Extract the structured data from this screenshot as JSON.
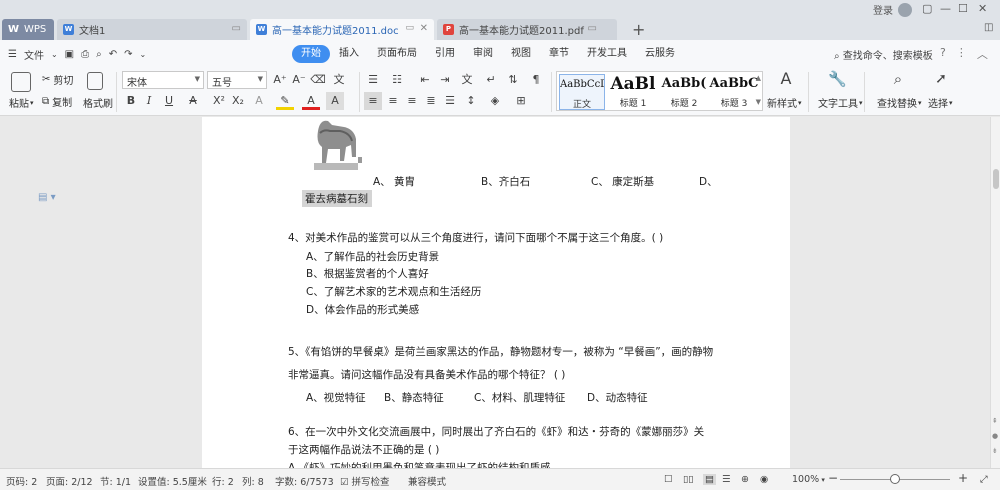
{
  "tabs": {
    "wps": "WPS",
    "doc1": "文档1",
    "doc2": "高一基本能力试题2011.doc",
    "pdf": "高一基本能力试题2011.pdf",
    "new_tab": "+"
  },
  "account": {
    "login": "登录"
  },
  "menubar": {
    "file": "文件",
    "items": [
      "开始",
      "插入",
      "页面布局",
      "引用",
      "审阅",
      "视图",
      "章节",
      "开发工具",
      "云服务"
    ],
    "active_index": 0,
    "search": "查找命令、搜索模板",
    "help": "?"
  },
  "ribbon": {
    "paste": "粘贴",
    "cut": "剪切",
    "copy": "复制",
    "format_painter": "格式刷",
    "font_name": "宋体",
    "font_size": "五号",
    "styles": [
      {
        "sample": "AaBbCcDd",
        "name": "正文"
      },
      {
        "sample": "AaBl",
        "name": "标题 1"
      },
      {
        "sample": "AaBb(",
        "name": "标题 2"
      },
      {
        "sample": "AaBbC",
        "name": "标题 3"
      }
    ],
    "new_style": "新样式",
    "text_tools": "文字工具",
    "find_replace": "查找替换",
    "select": "选择"
  },
  "document": {
    "q3_options": [
      "A、  黄胄",
      "B、齐白石",
      "C、  康定斯基",
      "D、"
    ],
    "q3_option_d_cont": "霍去病墓石刻",
    "q4": "4、对美术作品的鉴赏可以从三个角度进行，请问下面哪个不属于这三个角度。(                )",
    "q4_options": [
      "A、了解作品的社会历史背景",
      "B、根据鉴赏者的个人喜好",
      "C、了解艺术家的艺术观点和生活经历",
      "D、体会作品的形式美感"
    ],
    "q5_line1": "5、《有馅饼的早餐桌》是荷兰画家黑达的作品，静物题材专一，被称为 “早餐画”，画的静物",
    "q5_line2": "非常逼真。请问这幅作品没有具备美术作品的哪个特征？                  (                )",
    "q5_options": [
      "A、视觉特征",
      "B、静态特征",
      "C、材料、肌理特征",
      "D、动态特征"
    ],
    "q6_line1": "6、在一次中外文化交流画展中，同时展出了齐白石的《虾》和达・芬奇的《蒙娜丽莎》关",
    "q6_line2": "于这两幅作品说法不正确的是                                          (                )",
    "q6_line3": "A 《虾》巧妙的利用墨色和笔意表现出了虾的结构和质感"
  },
  "statusbar": {
    "page_no": "页码: 2",
    "pages": "页面: 2/12",
    "section": "节: 1/1",
    "setting": "设置值: 5.5厘米",
    "row": "行: 2",
    "col": "列: 8",
    "words": "字数: 6/7573",
    "spell": "拼写检查",
    "compat": "兼容模式",
    "zoom": "100%",
    "zoom_minus": "−",
    "zoom_plus": "+",
    "zoom_level": 0.5
  }
}
